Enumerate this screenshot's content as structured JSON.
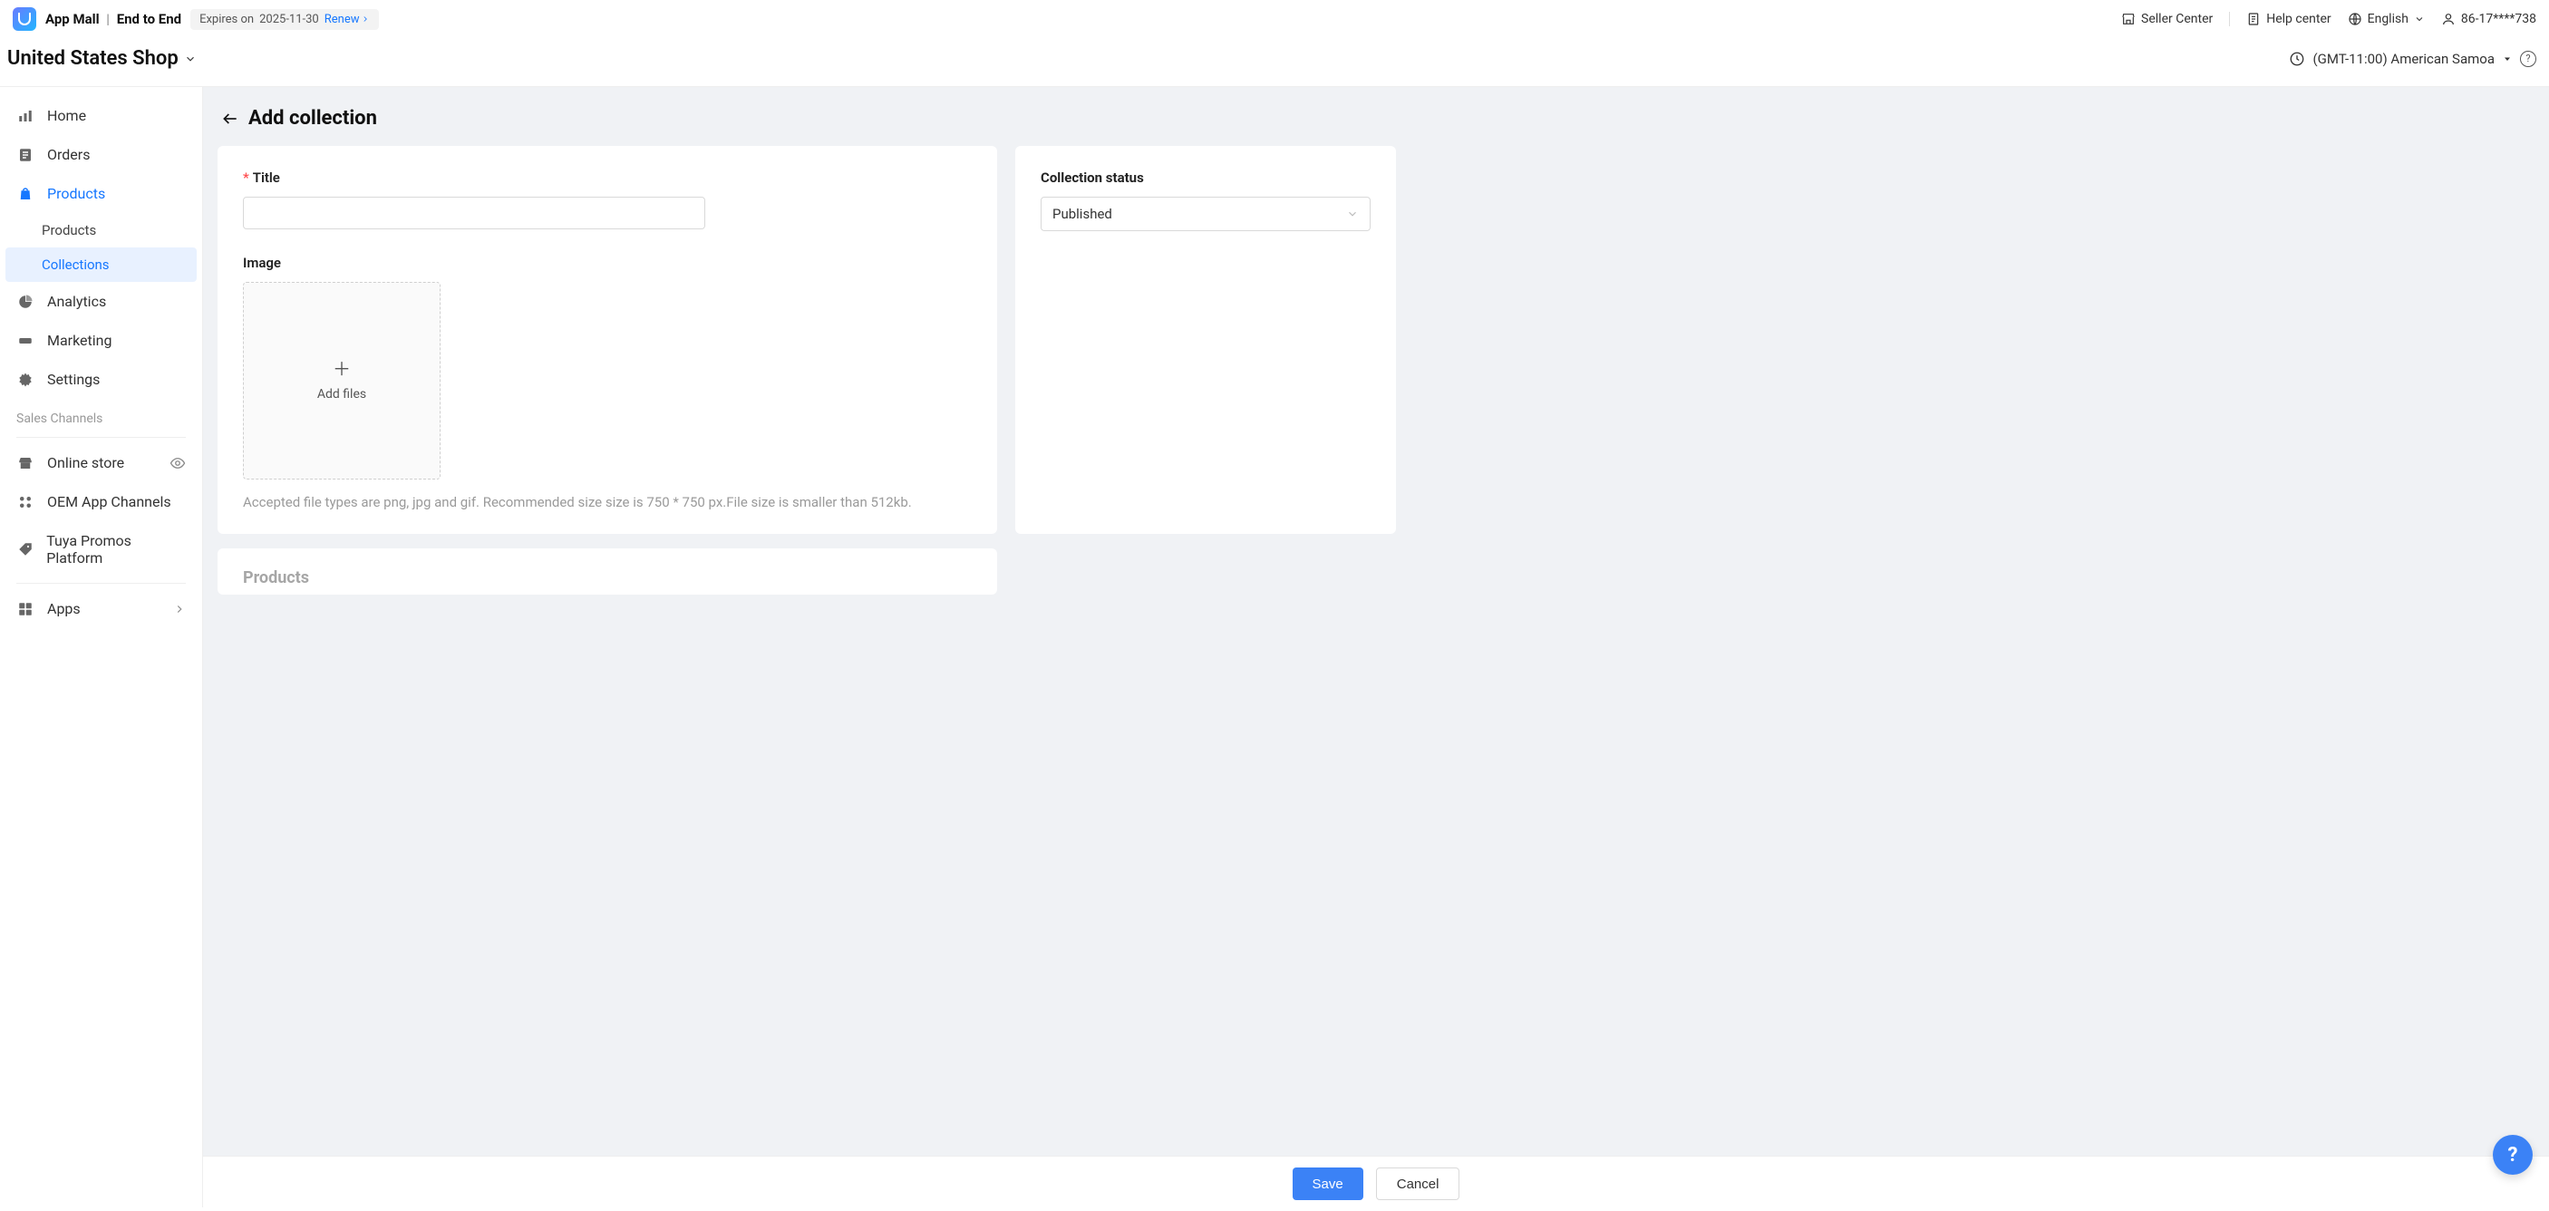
{
  "header": {
    "brand_left": "App Mall",
    "brand_right": "End to End",
    "expiry_prefix": "Expires on",
    "expiry_date": "2025-11-30",
    "renew_label": "Renew",
    "seller_center": "Seller Center",
    "help_center": "Help center",
    "language": "English",
    "user_id": "86-17****738"
  },
  "shop": {
    "name": "United States Shop",
    "timezone": "(GMT-11:00) American Samoa"
  },
  "sidebar": {
    "home": "Home",
    "orders": "Orders",
    "products": "Products",
    "products_sub": "Products",
    "collections_sub": "Collections",
    "analytics": "Analytics",
    "marketing": "Marketing",
    "settings": "Settings",
    "section_label": "Sales Channels",
    "online_store": "Online store",
    "oem": "OEM App Channels",
    "tuya": "Tuya Promos Platform",
    "apps": "Apps"
  },
  "page": {
    "title": "Add collection",
    "title_label": "Title",
    "image_label": "Image",
    "add_files": "Add files",
    "image_hint": "Accepted file types are png, jpg and gif. Recommended size size is 750 * 750 px.File size is smaller than 512kb.",
    "products_heading": "Products",
    "status_label": "Collection status",
    "status_value": "Published",
    "save": "Save",
    "cancel": "Cancel"
  }
}
